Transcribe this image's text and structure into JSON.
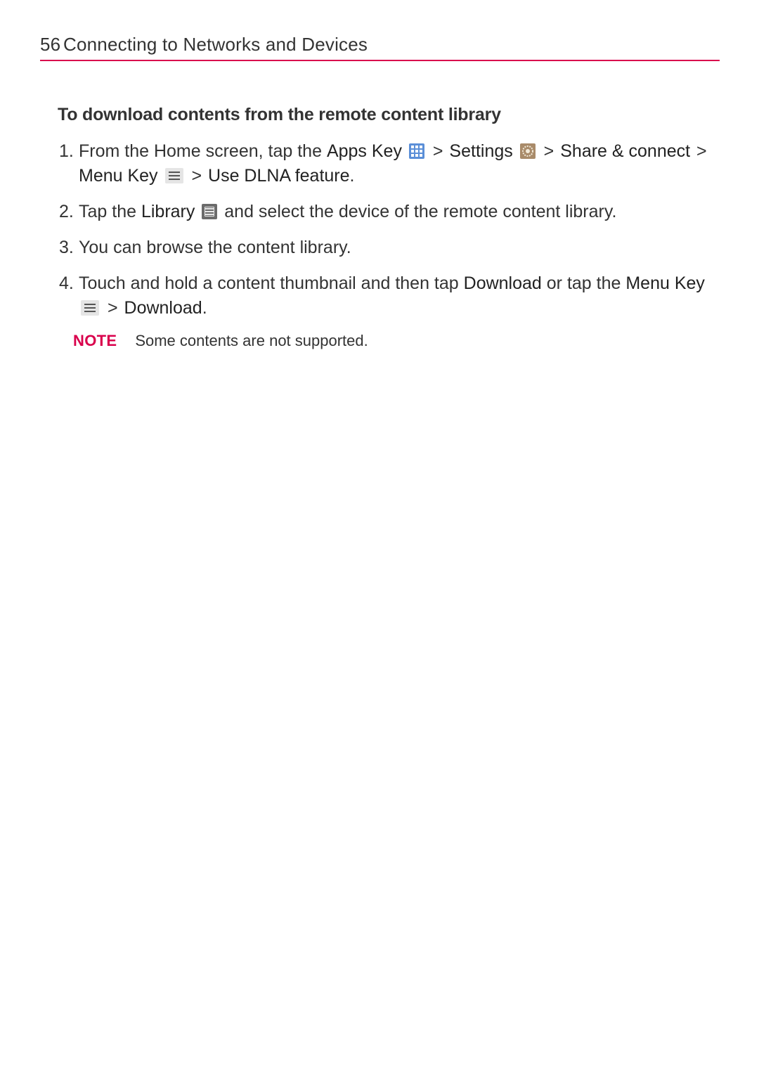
{
  "header": {
    "page_number": "56",
    "chapter_title": "Connecting to Networks and Devices"
  },
  "section": {
    "heading": "To download contents from the remote content library"
  },
  "steps": [
    {
      "n": "1.",
      "parts": {
        "a": "From the Home screen, tap the ",
        "apps_key": "Apps Key",
        "b": " ",
        "gt1": ">",
        "settings": "Settings",
        "gt2": ">",
        "share_connect": "Share & connect",
        "gt3": ">",
        "menu_key": "Menu Key",
        "gt4": ">",
        "use_dlna": "Use DLNA feature",
        "period": "."
      }
    },
    {
      "n": "2.",
      "parts": {
        "a": "Tap the ",
        "library": "Library",
        "b": " and select the device of the remote content library."
      }
    },
    {
      "n": "3.",
      "parts": {
        "a": "You can browse the content library."
      }
    },
    {
      "n": "4.",
      "parts": {
        "a": "Touch and hold a content thumbnail and then tap ",
        "download": "Download",
        "b": " or tap the ",
        "menu_key": "Menu Key",
        "gt": ">",
        "download2": "Download",
        "period": "."
      }
    }
  ],
  "note": {
    "label": "NOTE",
    "text": "Some contents are not supported."
  },
  "icons": {
    "apps": "apps-grid-icon",
    "settings": "settings-gear-icon",
    "menu": "menu-hamburger-icon",
    "library": "library-icon"
  }
}
